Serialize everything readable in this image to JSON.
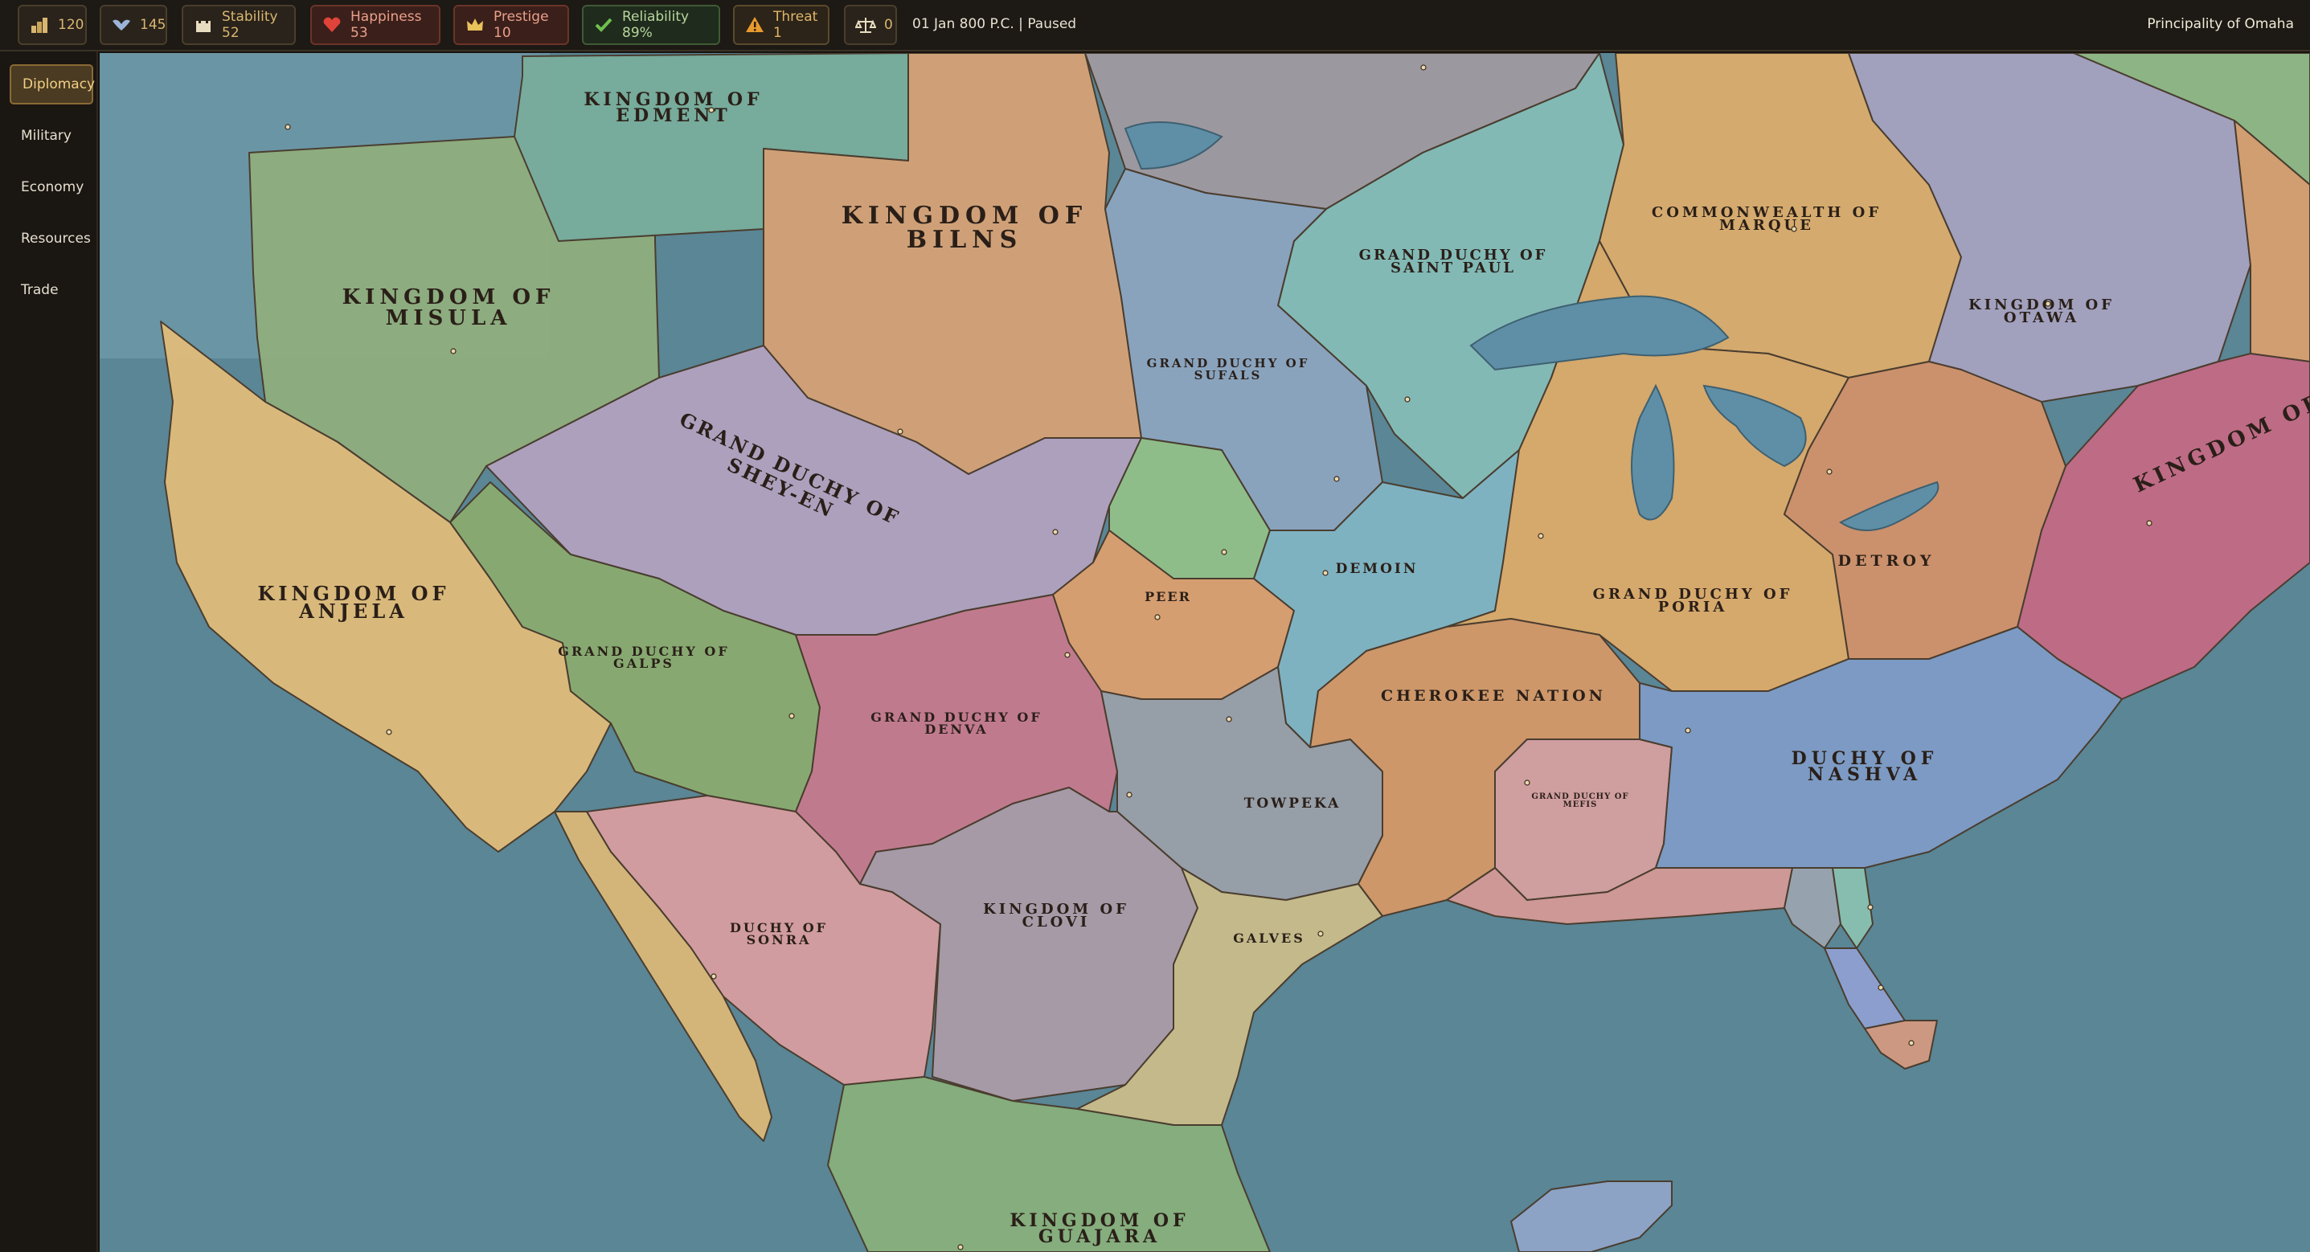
{
  "topbar": {
    "stats": [
      {
        "id": "gold",
        "icon": "treasury-icon",
        "value": "120"
      },
      {
        "id": "manpower",
        "icon": "manpower-wings-icon",
        "value": "145"
      },
      {
        "id": "stability",
        "icon": "castle-icon",
        "value": "Stability 52"
      },
      {
        "id": "happiness",
        "icon": "heart-icon",
        "value": "Happiness 53"
      },
      {
        "id": "prestige",
        "icon": "crown-icon",
        "value": "Prestige 10"
      },
      {
        "id": "reliability",
        "icon": "checkmark-icon",
        "value": "Reliability 89%"
      },
      {
        "id": "threat",
        "icon": "warning-triangle-icon",
        "value": "Threat 1"
      },
      {
        "id": "loans",
        "icon": "scales-icon",
        "value": "0"
      }
    ],
    "date_status": "01 Jan 800 P.C. | Paused",
    "nation": "Principality of Omaha"
  },
  "sidebar": {
    "items": [
      {
        "label": "Diplomacy",
        "active": true
      },
      {
        "label": "Military",
        "active": false
      },
      {
        "label": "Economy",
        "active": false
      },
      {
        "label": "Resources",
        "active": false
      },
      {
        "label": "Trade",
        "active": false
      }
    ]
  },
  "colors": {
    "ocean": "#5a8696",
    "topbar": "#1d1914",
    "accent": "#d8b670",
    "active_tab": "#4a3b22"
  },
  "map": {
    "labels": {
      "edment": [
        "KINGDOM OF",
        "EDMENT"
      ],
      "bilns": [
        "KINGDOM OF",
        "BILNS"
      ],
      "misula": [
        "KINGDOM OF",
        "MISULA"
      ],
      "shey_en": [
        "GRAND DUCHY OF",
        "SHEY-EN"
      ],
      "saint_paul": [
        "GRAND DUCHY OF",
        "SAINT PAUL"
      ],
      "sufals": [
        "GRAND DUCHY OF",
        "SUFALS"
      ],
      "marque": [
        "COMMONWEALTH OF",
        "MARQUE"
      ],
      "otawa": [
        "KINGDOM OF",
        "OTAWA"
      ],
      "kingdom_of_east": "KINGDOM OF",
      "anjela": [
        "KINGDOM OF",
        "ANJELA"
      ],
      "galps": [
        "GRAND DUCHY OF",
        "GALPS"
      ],
      "peer": "PEER",
      "demoin": "DEMOIN",
      "poria": [
        "GRAND DUCHY OF",
        "PORIA"
      ],
      "detroy": "DETROY",
      "denva": [
        "GRAND DUCHY OF",
        "DENVA"
      ],
      "cherokee": "CHEROKEE NATION",
      "nashva": [
        "DUCHY OF",
        "NASHVA"
      ],
      "towpeka": "TOWPEKA",
      "mefis": [
        "GRAND DUCHY OF",
        "MEFIS"
      ],
      "sonra": [
        "DUCHY OF",
        "SONRA"
      ],
      "clovi": [
        "KINGDOM OF",
        "CLOVI"
      ],
      "galves": "GALVES",
      "guajara": [
        "KINGDOM OF",
        "GUAJARA"
      ]
    }
  }
}
